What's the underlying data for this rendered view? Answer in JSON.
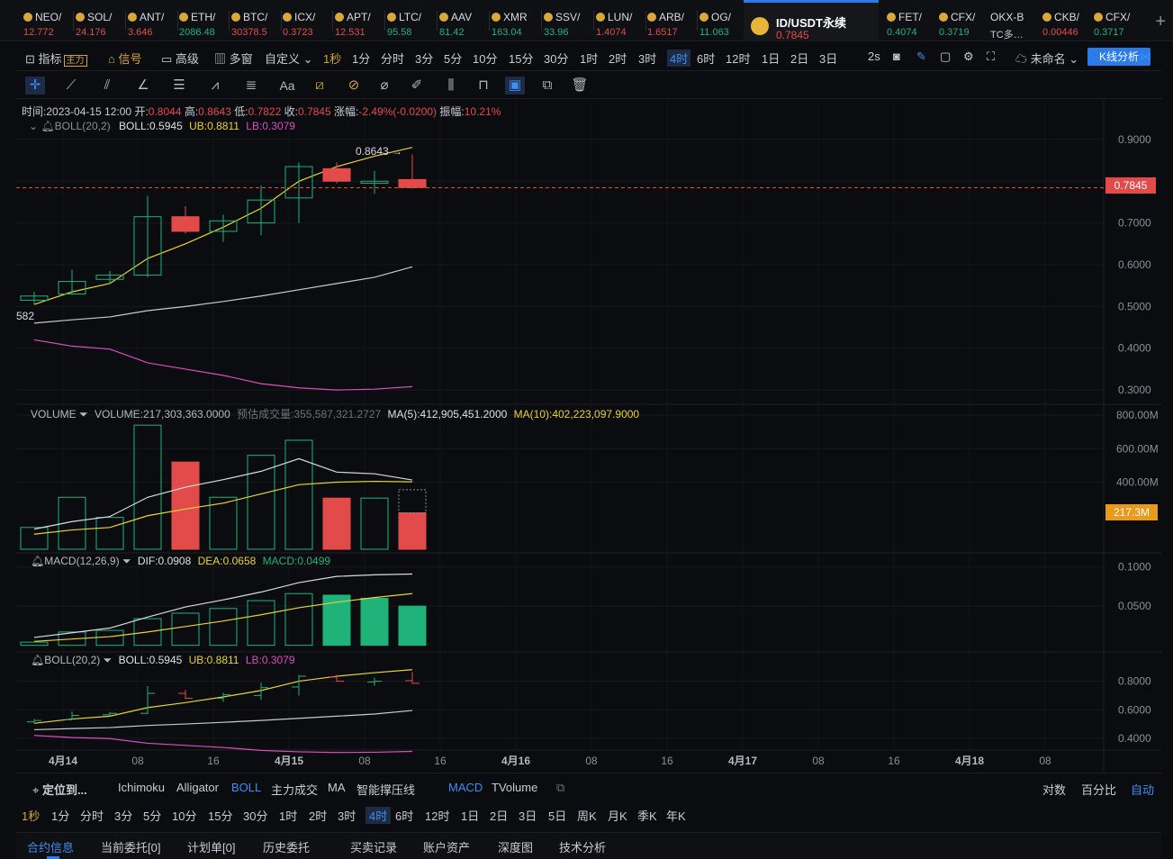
{
  "tickers": [
    {
      "name": "NEO/",
      "price": "12.772",
      "dir": "dn"
    },
    {
      "name": "SOL/",
      "price": "24.176",
      "dir": "dn"
    },
    {
      "name": "ANT/",
      "price": "3.646",
      "dir": "dn"
    },
    {
      "name": "ETH/",
      "price": "2086.48",
      "dir": "up"
    },
    {
      "name": "BTC/",
      "price": "30378.5",
      "dir": "dn"
    },
    {
      "name": "ICX/",
      "price": "0.3723",
      "dir": "dn"
    },
    {
      "name": "APT/",
      "price": "12.531",
      "dir": "dn"
    },
    {
      "name": "LTC/",
      "price": "95.58",
      "dir": "up"
    },
    {
      "name": "AAV",
      "price": "81.42",
      "dir": "up"
    },
    {
      "name": "XMR",
      "price": "163.04",
      "dir": "up"
    },
    {
      "name": "SSV/",
      "price": "33.96",
      "dir": "up"
    },
    {
      "name": "LUN/",
      "price": "1.4074",
      "dir": "dn"
    },
    {
      "name": "ARB/",
      "price": "1.6517",
      "dir": "dn"
    },
    {
      "name": "OG/",
      "price": "11.063",
      "dir": "up"
    }
  ],
  "active_ticker": {
    "name": "ID/USDT永续",
    "price": "0.7845"
  },
  "tickers_right": [
    {
      "name": "FET/",
      "price": "0.4074",
      "dir": "up"
    },
    {
      "name": "CFX/",
      "price": "0.3719",
      "dir": "up"
    },
    {
      "name": "OKX-B",
      "price": "TC多…",
      "dir": "none"
    },
    {
      "name": "CKB/",
      "price": "0.00446",
      "dir": "dn"
    },
    {
      "name": "CFX/",
      "price": "0.3717",
      "dir": "up"
    }
  ],
  "intervals_bar": {
    "indicator": "指标",
    "main": "主力",
    "signal": "信号",
    "advanced": "高级",
    "multi": "多窗",
    "custom": "自定义",
    "intervals": [
      "1秒",
      "1分",
      "分时",
      "3分",
      "5分",
      "10分",
      "15分",
      "30分",
      "1时",
      "2时",
      "3时",
      "4时",
      "6时",
      "12时",
      "1日",
      "2日",
      "3日"
    ],
    "selected": "4时",
    "refresh": "2s",
    "unnamed": "未命名",
    "kline": "K线分析"
  },
  "ohlc_info": {
    "time_label": "时间:",
    "time": "2023-04-15 12:00",
    "open_label": "开:",
    "open": "0.8044",
    "high_label": "高:",
    "high": "0.8643",
    "low_label": "低:",
    "low": "0.7822",
    "close_label": "收:",
    "close": "0.7845",
    "change_label": "涨幅:",
    "change": "-2.49%(-0.0200)",
    "amp_label": "振幅:",
    "amp": "10.21%"
  },
  "boll_main": {
    "name": "BOLL(20,2)",
    "boll": "BOLL:0.5945",
    "ub": "UB:0.8811",
    "lb": "LB:0.3079"
  },
  "price_axis": [
    "0.9000",
    "0.8000",
    "0.7000",
    "0.6000",
    "0.5000",
    "0.4000",
    "0.3000"
  ],
  "current_price_tag": "0.7845",
  "high_marker": "0.8643 →",
  "left_cut_label": "582",
  "volume_panel": {
    "name": "VOLUME",
    "volume": "VOLUME:217,303,363.0000",
    "est_label": "预估成交量:355,587,321.2727",
    "ma5": "MA(5):412,905,451.2000",
    "ma10": "MA(10):402,223,097.9000"
  },
  "volume_axis": [
    "800.00M",
    "600.00M",
    "400.00M"
  ],
  "volume_tag": "217.3M",
  "macd_panel": {
    "name": "MACD(12,26,9)",
    "dif": "DIF:0.0908",
    "dea": "DEA:0.0658",
    "macd": "MACD:0.0499"
  },
  "macd_axis": [
    "0.1000",
    "0.0500"
  ],
  "boll_panel": {
    "name": "BOLL(20,2)",
    "boll": "BOLL:0.5945",
    "ub": "UB:0.8811",
    "lb": "LB:0.3079"
  },
  "boll_axis": [
    "0.8000",
    "0.6000",
    "0.4000"
  ],
  "time_axis": [
    "4月14",
    "08",
    "16",
    "4月15",
    "08",
    "16",
    "4月16",
    "08",
    "16",
    "4月17",
    "08",
    "16",
    "4月18",
    "08"
  ],
  "chart_data": {
    "type": "candlestick",
    "candles": [
      {
        "o": 0.515,
        "h": 0.535,
        "l": 0.505,
        "c": 0.525
      },
      {
        "o": 0.53,
        "h": 0.588,
        "l": 0.528,
        "c": 0.56
      },
      {
        "o": 0.565,
        "h": 0.585,
        "l": 0.555,
        "c": 0.575
      },
      {
        "o": 0.575,
        "h": 0.765,
        "l": 0.57,
        "c": 0.715
      },
      {
        "o": 0.715,
        "h": 0.74,
        "l": 0.675,
        "c": 0.68
      },
      {
        "o": 0.68,
        "h": 0.72,
        "l": 0.655,
        "c": 0.705
      },
      {
        "o": 0.7,
        "h": 0.79,
        "l": 0.67,
        "c": 0.755
      },
      {
        "o": 0.76,
        "h": 0.845,
        "l": 0.7,
        "c": 0.835
      },
      {
        "o": 0.83,
        "h": 0.845,
        "l": 0.795,
        "c": 0.8
      },
      {
        "o": 0.795,
        "h": 0.825,
        "l": 0.77,
        "c": 0.8
      },
      {
        "o": 0.804,
        "h": 0.864,
        "l": 0.782,
        "c": 0.785
      }
    ],
    "boll_mid": [
      0.46,
      0.468,
      0.475,
      0.49,
      0.5,
      0.512,
      0.525,
      0.54,
      0.555,
      0.57,
      0.595
    ],
    "boll_ub": [
      0.505,
      0.535,
      0.555,
      0.615,
      0.65,
      0.69,
      0.735,
      0.8,
      0.835,
      0.86,
      0.881
    ],
    "boll_lb": [
      0.42,
      0.405,
      0.398,
      0.365,
      0.35,
      0.335,
      0.315,
      0.305,
      0.3,
      0.302,
      0.308
    ],
    "volume": [
      130,
      310,
      190,
      740,
      520,
      310,
      560,
      650,
      305,
      305,
      217
    ],
    "volume_dir": [
      "up",
      "up",
      "up",
      "up",
      "dn",
      "up",
      "up",
      "up",
      "dn",
      "up",
      "dn"
    ],
    "vol_ma5": [
      120,
      165,
      195,
      310,
      370,
      415,
      465,
      540,
      460,
      450,
      413
    ],
    "vol_ma10": [
      90,
      115,
      130,
      200,
      240,
      275,
      330,
      385,
      400,
      405,
      402
    ],
    "macd_hist": [
      0.004,
      0.017,
      0.019,
      0.034,
      0.041,
      0.047,
      0.057,
      0.066,
      0.064,
      0.06,
      0.05
    ],
    "macd_dif": [
      0.01,
      0.016,
      0.022,
      0.036,
      0.049,
      0.058,
      0.068,
      0.08,
      0.088,
      0.09,
      0.091
    ],
    "macd_dea": [
      0.005,
      0.008,
      0.011,
      0.017,
      0.024,
      0.031,
      0.039,
      0.048,
      0.055,
      0.061,
      0.066
    ],
    "ylim_price": [
      0.27,
      0.93
    ],
    "ylim_volume": [
      0,
      800
    ],
    "ylim_macd": [
      -0.005,
      0.11
    ],
    "ylim_boll": [
      0.33,
      0.93
    ]
  },
  "indicator_bar": {
    "locate": "定位到...",
    "items": [
      "Ichimoku",
      "Alligator",
      "BOLL",
      "主力成交",
      "MA",
      "智能撑压线"
    ],
    "active": "BOLL",
    "sub_items": [
      "MACD",
      "TVolume"
    ],
    "sub_active": "MACD",
    "log": "对数",
    "percent": "百分比",
    "auto": "自动"
  },
  "period_bar": [
    "1秒",
    "1分",
    "分时",
    "3分",
    "5分",
    "10分",
    "15分",
    "30分",
    "1时",
    "2时",
    "3时",
    "4时",
    "6时",
    "12时",
    "1日",
    "2日",
    "3日",
    "5日",
    "周K",
    "月K",
    "季K",
    "年K"
  ],
  "period_selected": "4时",
  "bottom_tabs": [
    "合约信息",
    "当前委托[0]",
    "计划单[0]",
    "历史委托",
    "买卖记录",
    "账户资产",
    "深度图",
    "技术分析"
  ],
  "colors": {
    "up": "#1fb37a",
    "down": "#e34b4b",
    "accent": "#2b7ce9",
    "ub": "#e8d23a",
    "lb": "#d94fc0",
    "mid": "#c8cad0"
  }
}
